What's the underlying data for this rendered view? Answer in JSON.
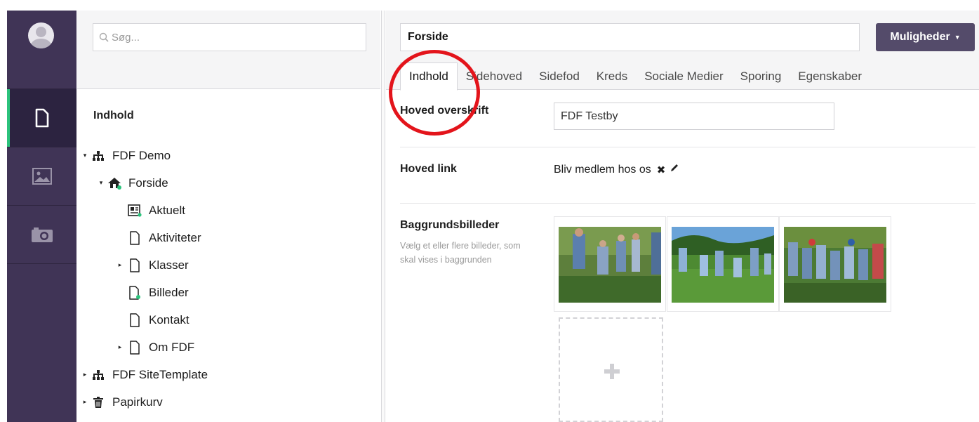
{
  "tree": {
    "search_placeholder": "Søg...",
    "section_title": "Indhold",
    "nodes": [
      {
        "label": "FDF Demo",
        "icon": "sitemap-icon",
        "caret": "▾"
      },
      {
        "label": "Forside",
        "icon": "home-icon",
        "caret": "▾"
      },
      {
        "label": "Aktuelt",
        "icon": "newspaper-icon",
        "caret": ""
      },
      {
        "label": "Aktiviteter",
        "icon": "document-icon",
        "caret": ""
      },
      {
        "label": "Klasser",
        "icon": "document-icon",
        "caret": "▸"
      },
      {
        "label": "Billeder",
        "icon": "document-plus-icon",
        "caret": ""
      },
      {
        "label": "Kontakt",
        "icon": "document-icon",
        "caret": ""
      },
      {
        "label": "Om FDF",
        "icon": "document-icon",
        "caret": "▸"
      },
      {
        "label": "FDF SiteTemplate",
        "icon": "sitemap-icon",
        "caret": "▸"
      },
      {
        "label": "Papirkurv",
        "icon": "trash-icon",
        "caret": "▸"
      }
    ]
  },
  "editor": {
    "node_name": "Forside",
    "options_label": "Muligheder",
    "tabs": [
      "Indhold",
      "Sidehoved",
      "Sidefod",
      "Kreds",
      "Sociale Medier",
      "Sporing",
      "Egenskaber"
    ],
    "active_tab": "Indhold",
    "props": {
      "headline_label": "Hoved overskrift",
      "headline_value": "FDF Testby",
      "link_label": "Hoved link",
      "link_value": "Bliv medlem hos os",
      "bg_label": "Baggrundsbilleder",
      "bg_desc": "Vælg et eller flere billeder, som skal vises i baggrunden"
    }
  },
  "colors": {
    "rail_bg": "#403456",
    "active_accent": "#2bc37c",
    "button_bg": "#544b6a",
    "annotation": "#e3141b"
  }
}
